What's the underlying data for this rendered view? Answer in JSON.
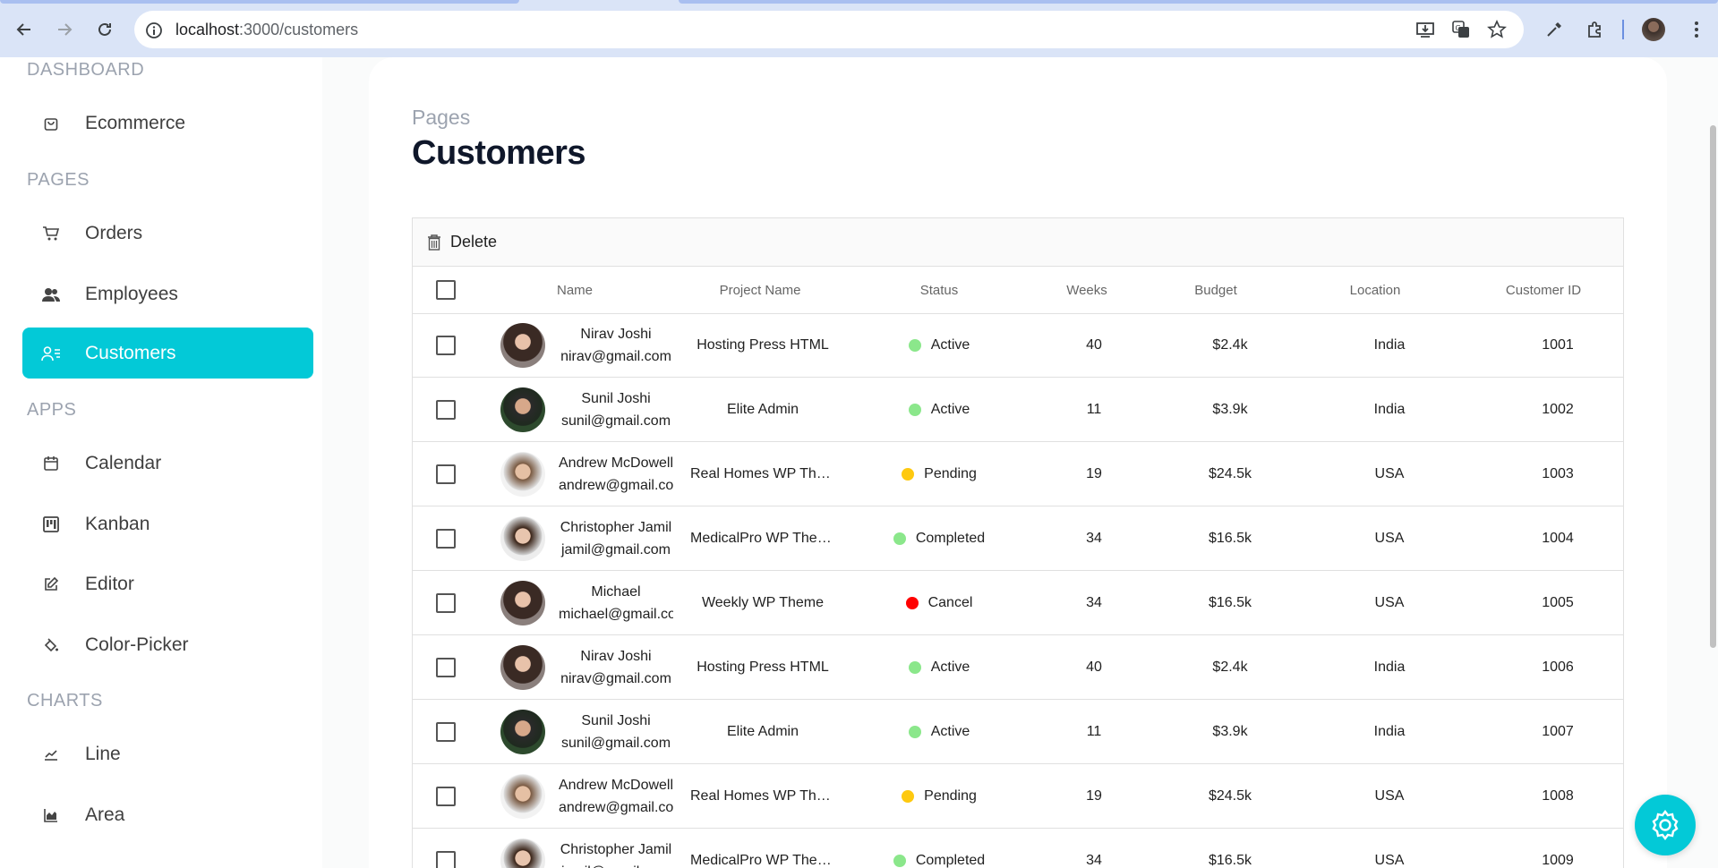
{
  "browser": {
    "url_host": "localhost",
    "url_path": ":3000/customers"
  },
  "sidebar": {
    "sections": [
      {
        "title": "DASHBOARD",
        "items": [
          {
            "label": "Ecommerce",
            "icon": "shopping-bag-icon"
          }
        ]
      },
      {
        "title": "PAGES",
        "items": [
          {
            "label": "Orders",
            "icon": "cart-icon"
          },
          {
            "label": "Employees",
            "icon": "employees-icon"
          },
          {
            "label": "Customers",
            "icon": "customers-icon",
            "active": true
          }
        ]
      },
      {
        "title": "APPS",
        "items": [
          {
            "label": "Calendar",
            "icon": "calendar-icon"
          },
          {
            "label": "Kanban",
            "icon": "kanban-icon"
          },
          {
            "label": "Editor",
            "icon": "edit-icon"
          },
          {
            "label": "Color-Picker",
            "icon": "paint-bucket-icon"
          }
        ]
      },
      {
        "title": "CHARTS",
        "items": [
          {
            "label": "Line",
            "icon": "line-chart-icon"
          },
          {
            "label": "Area",
            "icon": "area-chart-icon"
          }
        ]
      }
    ],
    "accent": "#03c9d7"
  },
  "header": {
    "crumb": "Pages",
    "title": "Customers"
  },
  "grid": {
    "toolbar_delete": "Delete",
    "columns": [
      "Name",
      "Project Name",
      "Status",
      "Weeks",
      "Budget",
      "Location",
      "Customer ID"
    ],
    "rows": [
      {
        "name": "Nirav Joshi",
        "email": "nirav@gmail.com",
        "project": "Hosting Press HTML",
        "status": "Active",
        "status_color": "#8be78b",
        "weeks": "40",
        "budget": "$2.4k",
        "location": "India",
        "id": "1001",
        "avatar": "woman-1"
      },
      {
        "name": "Sunil Joshi",
        "email": "sunil@gmail.com",
        "project": "Elite Admin",
        "status": "Active",
        "status_color": "#8be78b",
        "weeks": "11",
        "budget": "$3.9k",
        "location": "India",
        "id": "1002",
        "avatar": "man-1"
      },
      {
        "name": "Andrew McDowell",
        "email": "andrew@gmail.com",
        "project": "Real Homes WP Theme",
        "status": "Pending",
        "status_color": "#fec90f",
        "weeks": "19",
        "budget": "$24.5k",
        "location": "USA",
        "id": "1003",
        "avatar": "man-2"
      },
      {
        "name": "Christopher Jamil",
        "email": "jamil@gmail.com",
        "project": "MedicalPro WP Theme",
        "status": "Completed",
        "status_color": "#8be78b",
        "weeks": "34",
        "budget": "$16.5k",
        "location": "USA",
        "id": "1004",
        "avatar": "man-3"
      },
      {
        "name": "Michael",
        "email": "michael@gmail.com",
        "project": "Weekly WP Theme",
        "status": "Cancel",
        "status_color": "#ff0000",
        "weeks": "34",
        "budget": "$16.5k",
        "location": "USA",
        "id": "1005",
        "avatar": "woman-1"
      },
      {
        "name": "Nirav Joshi",
        "email": "nirav@gmail.com",
        "project": "Hosting Press HTML",
        "status": "Active",
        "status_color": "#8be78b",
        "weeks": "40",
        "budget": "$2.4k",
        "location": "India",
        "id": "1006",
        "avatar": "woman-1"
      },
      {
        "name": "Sunil Joshi",
        "email": "sunil@gmail.com",
        "project": "Elite Admin",
        "status": "Active",
        "status_color": "#8be78b",
        "weeks": "11",
        "budget": "$3.9k",
        "location": "India",
        "id": "1007",
        "avatar": "man-1"
      },
      {
        "name": "Andrew McDowell",
        "email": "andrew@gmail.com",
        "project": "Real Homes WP Theme",
        "status": "Pending",
        "status_color": "#fec90f",
        "weeks": "19",
        "budget": "$24.5k",
        "location": "USA",
        "id": "1008",
        "avatar": "man-2"
      },
      {
        "name": "Christopher Jamil",
        "email": "jamil@gmail.com",
        "project": "MedicalPro WP Theme",
        "status": "Completed",
        "status_color": "#8be78b",
        "weeks": "34",
        "budget": "$16.5k",
        "location": "USA",
        "id": "1009",
        "avatar": "man-3"
      }
    ]
  }
}
